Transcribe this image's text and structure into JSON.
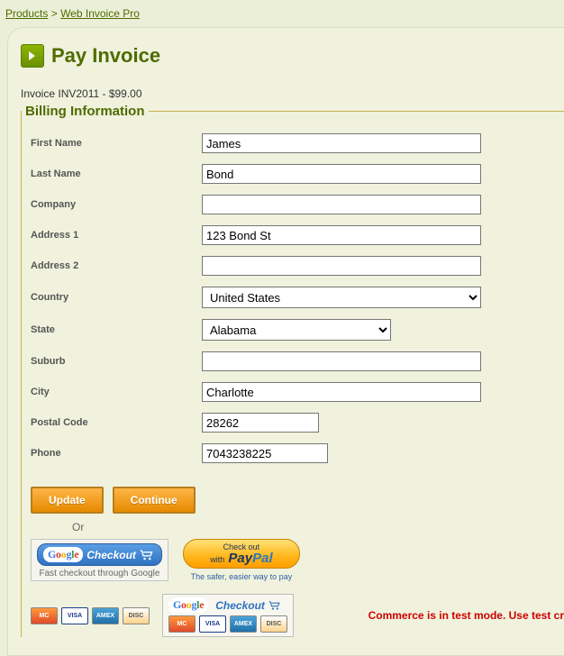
{
  "breadcrumb": {
    "products": "Products",
    "sep": ">",
    "current": "Web Invoice Pro"
  },
  "page_title": "Pay Invoice",
  "invoice_line": "Invoice INV2011 - $99.00",
  "legend": "Billing Information",
  "labels": {
    "first_name": "First Name",
    "last_name": "Last Name",
    "company": "Company",
    "address1": "Address 1",
    "address2": "Address 2",
    "country": "Country",
    "state": "State",
    "suburb": "Suburb",
    "city": "City",
    "postal": "Postal Code",
    "phone": "Phone"
  },
  "values": {
    "first_name": "James",
    "last_name": "Bond",
    "company": "",
    "address1": "123 Bond St",
    "address2": "",
    "country": "United States",
    "state": "Alabama",
    "suburb": "",
    "city": "Charlotte",
    "postal": "28262",
    "phone": "7043238225"
  },
  "buttons": {
    "update": "Update",
    "continue": "Continue"
  },
  "or_label": "Or",
  "google_checkout": {
    "btn_text": "Checkout",
    "tagline": "Fast checkout through Google"
  },
  "paypal": {
    "top": "Check out",
    "with": "with",
    "brand_pay": "Pay",
    "brand_pal": "Pal",
    "tagline": "The safer, easier way to pay"
  },
  "google_box2_label": "Checkout",
  "test_notice": "Commerce is in test mode. Use test cr"
}
